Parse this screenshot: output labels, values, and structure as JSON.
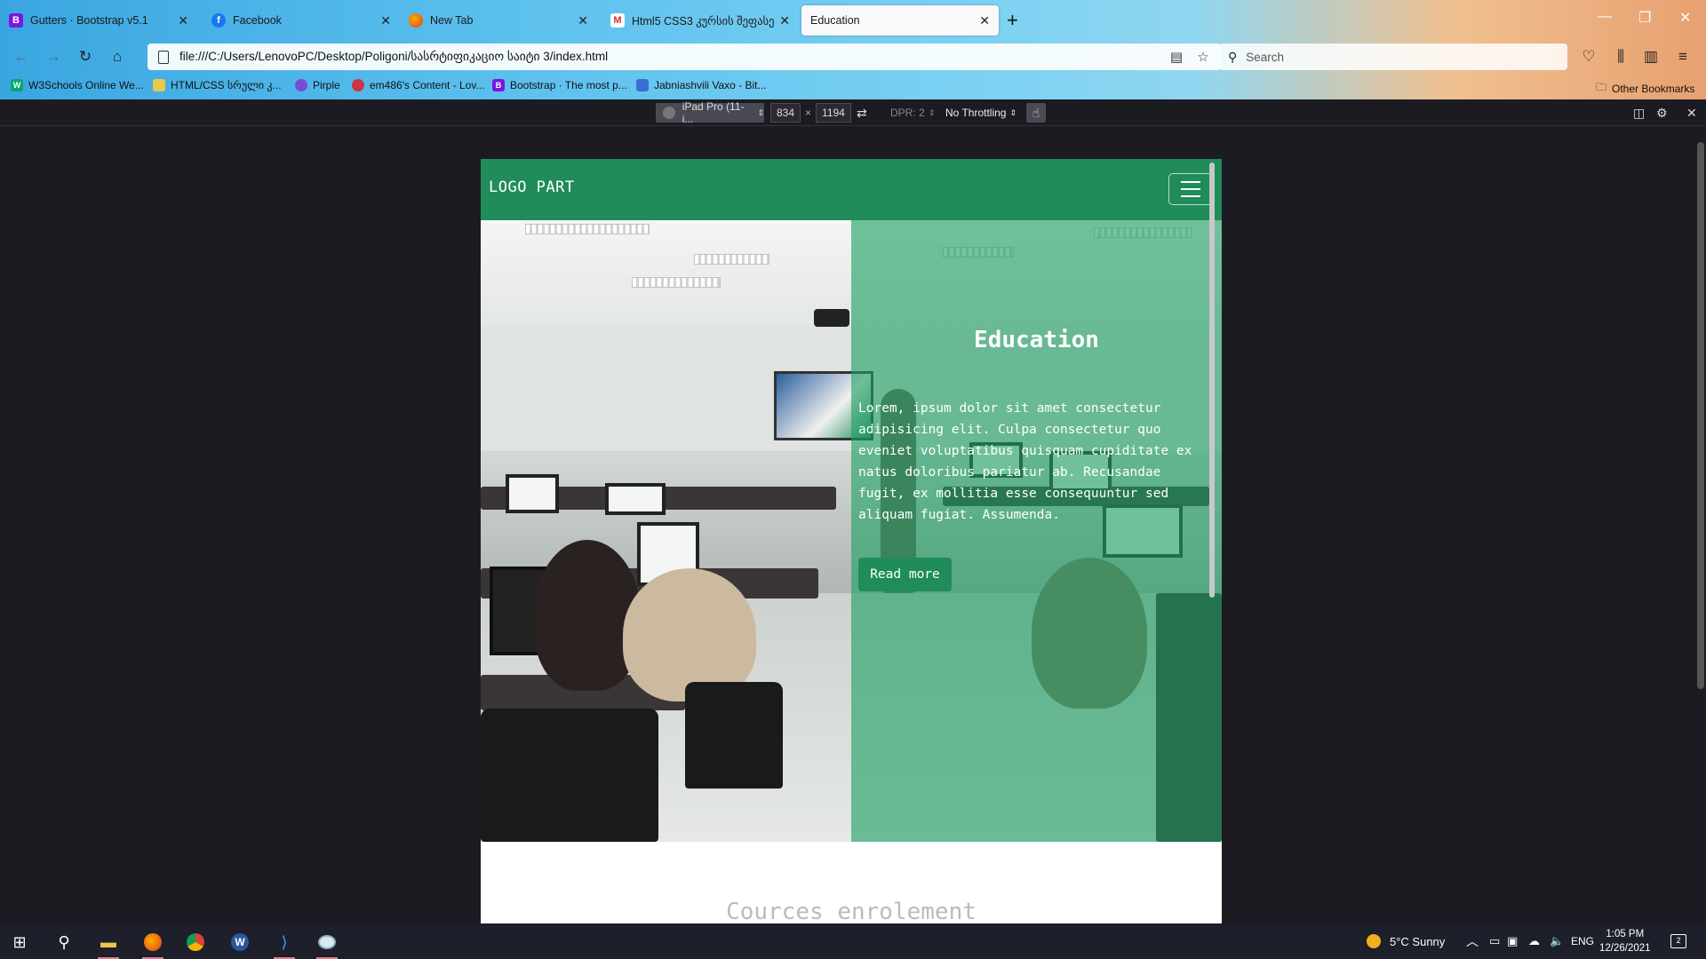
{
  "browser": {
    "tabs": [
      {
        "label": "Gutters · Bootstrap v5.1",
        "favicon": "B"
      },
      {
        "label": "Facebook",
        "favicon": "f"
      },
      {
        "label": "New Tab",
        "favicon": "firefox"
      },
      {
        "label": "Html5 CSS3 კურსის შეფასებ",
        "favicon": "M"
      },
      {
        "label": "Education",
        "favicon": ""
      }
    ],
    "url": "file:///C:/Users/LenovoPC/Desktop/Poligoni/სასრტიფიკაციო საიტი 3/index.html",
    "search_placeholder": "Search",
    "bookmarks": [
      {
        "label": "W3Schools Online We...",
        "favicon": "W",
        "color": "#04aa6d"
      },
      {
        "label": "HTML/CSS სრული კ...",
        "favicon": "",
        "color": "#e8c94a"
      },
      {
        "label": "Pirple",
        "favicon": "",
        "color": "#7a4bd6"
      },
      {
        "label": "em486's Content - Lov...",
        "favicon": "",
        "color": "#cc3344"
      },
      {
        "label": "Bootstrap · The most p...",
        "favicon": "B",
        "color": "#7a18e0"
      },
      {
        "label": "Jabniashvili Vaxo - Bit...",
        "favicon": "",
        "color": "#3a6fd0"
      }
    ],
    "other_bookmarks": "Other Bookmarks"
  },
  "responsive_toolbar": {
    "device": "iPad Pro (11-i...",
    "width": "834",
    "times": "×",
    "height": "1194",
    "dpr": "DPR: 2",
    "throttling": "No Throttling"
  },
  "site": {
    "logo": "LOGO PART",
    "hero": {
      "title": "Education",
      "text": "Lorem, ipsum dolor sit amet consectetur adipisicing elit. Culpa consectetur quo eveniet voluptatibus quisquam cupiditate ex natus doloribus pariatur ab. Recusandae fugit, ex mollitia esse consequuntur sed aliquam fugiat. Assumenda.",
      "button": "Read more"
    },
    "section_title": "Cources enrolement",
    "brand_color": "#1f8c5a"
  },
  "taskbar": {
    "weather": "5°C  Sunny",
    "language": "ENG",
    "time": "1:05 PM",
    "date": "12/26/2021",
    "notification_count": "2"
  }
}
